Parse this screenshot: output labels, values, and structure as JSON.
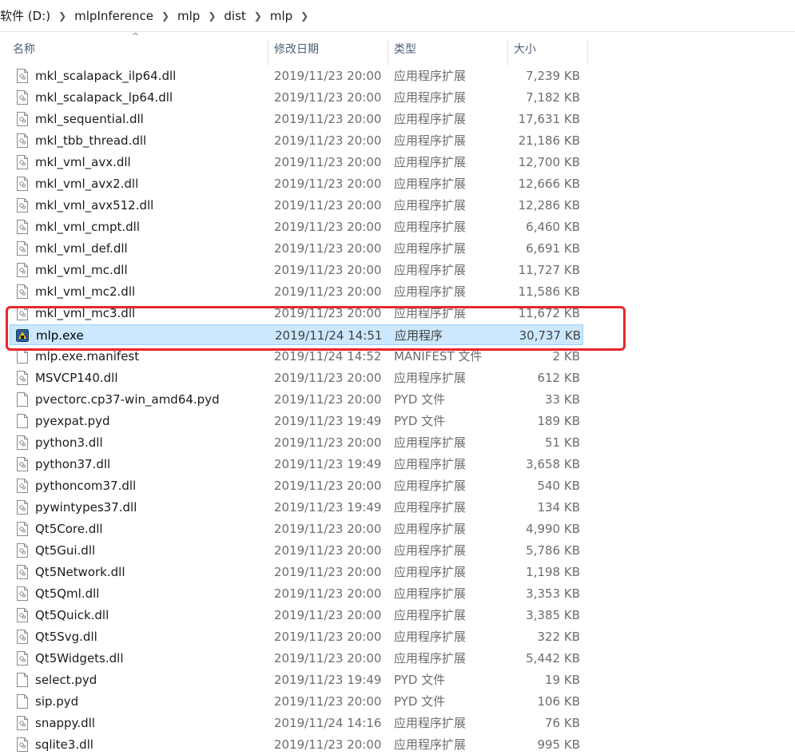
{
  "breadcrumb": [
    "软件 (D:)",
    "mlpInference",
    "mlp",
    "dist",
    "mlp"
  ],
  "columns": {
    "name": "名称",
    "date": "修改日期",
    "type": "类型",
    "size": "大小"
  },
  "colors": {
    "selected_bg": "#cce8ff",
    "selected_border": "#99d1ff",
    "highlight": "#e8262a"
  },
  "files": [
    {
      "name": "mkl_scalapack_ilp64.dll",
      "date": "2019/11/23 20:00",
      "type": "应用程序扩展",
      "size": "7,239 KB",
      "icon": "dll-file-icon"
    },
    {
      "name": "mkl_scalapack_lp64.dll",
      "date": "2019/11/23 20:00",
      "type": "应用程序扩展",
      "size": "7,182 KB",
      "icon": "dll-file-icon"
    },
    {
      "name": "mkl_sequential.dll",
      "date": "2019/11/23 20:00",
      "type": "应用程序扩展",
      "size": "17,631 KB",
      "icon": "dll-file-icon"
    },
    {
      "name": "mkl_tbb_thread.dll",
      "date": "2019/11/23 20:00",
      "type": "应用程序扩展",
      "size": "21,186 KB",
      "icon": "dll-file-icon"
    },
    {
      "name": "mkl_vml_avx.dll",
      "date": "2019/11/23 20:00",
      "type": "应用程序扩展",
      "size": "12,700 KB",
      "icon": "dll-file-icon"
    },
    {
      "name": "mkl_vml_avx2.dll",
      "date": "2019/11/23 20:00",
      "type": "应用程序扩展",
      "size": "12,666 KB",
      "icon": "dll-file-icon"
    },
    {
      "name": "mkl_vml_avx512.dll",
      "date": "2019/11/23 20:00",
      "type": "应用程序扩展",
      "size": "12,286 KB",
      "icon": "dll-file-icon"
    },
    {
      "name": "mkl_vml_cmpt.dll",
      "date": "2019/11/23 20:00",
      "type": "应用程序扩展",
      "size": "6,460 KB",
      "icon": "dll-file-icon"
    },
    {
      "name": "mkl_vml_def.dll",
      "date": "2019/11/23 20:00",
      "type": "应用程序扩展",
      "size": "6,691 KB",
      "icon": "dll-file-icon"
    },
    {
      "name": "mkl_vml_mc.dll",
      "date": "2019/11/23 20:00",
      "type": "应用程序扩展",
      "size": "11,727 KB",
      "icon": "dll-file-icon"
    },
    {
      "name": "mkl_vml_mc2.dll",
      "date": "2019/11/23 20:00",
      "type": "应用程序扩展",
      "size": "11,586 KB",
      "icon": "dll-file-icon"
    },
    {
      "name": "mkl_vml_mc3.dll",
      "date": "2019/11/23 20:00",
      "type": "应用程序扩展",
      "size": "11,672 KB",
      "icon": "dll-file-icon"
    },
    {
      "name": "mlp.exe",
      "date": "2019/11/24 14:51",
      "type": "应用程序",
      "size": "30,737 KB",
      "icon": "exe-app-icon",
      "selected": true
    },
    {
      "name": "mlp.exe.manifest",
      "date": "2019/11/24 14:52",
      "type": "MANIFEST 文件",
      "size": "2 KB",
      "icon": "blank-file-icon"
    },
    {
      "name": "MSVCP140.dll",
      "date": "2019/11/23 20:00",
      "type": "应用程序扩展",
      "size": "612 KB",
      "icon": "dll-file-icon"
    },
    {
      "name": "pvectorc.cp37-win_amd64.pyd",
      "date": "2019/11/23 20:00",
      "type": "PYD 文件",
      "size": "33 KB",
      "icon": "blank-file-icon"
    },
    {
      "name": "pyexpat.pyd",
      "date": "2019/11/23 19:49",
      "type": "PYD 文件",
      "size": "189 KB",
      "icon": "blank-file-icon"
    },
    {
      "name": "python3.dll",
      "date": "2019/11/23 20:00",
      "type": "应用程序扩展",
      "size": "51 KB",
      "icon": "dll-file-icon"
    },
    {
      "name": "python37.dll",
      "date": "2019/11/23 19:49",
      "type": "应用程序扩展",
      "size": "3,658 KB",
      "icon": "dll-file-icon"
    },
    {
      "name": "pythoncom37.dll",
      "date": "2019/11/23 20:00",
      "type": "应用程序扩展",
      "size": "540 KB",
      "icon": "dll-file-icon"
    },
    {
      "name": "pywintypes37.dll",
      "date": "2019/11/23 19:49",
      "type": "应用程序扩展",
      "size": "134 KB",
      "icon": "dll-file-icon"
    },
    {
      "name": "Qt5Core.dll",
      "date": "2019/11/23 20:00",
      "type": "应用程序扩展",
      "size": "4,990 KB",
      "icon": "dll-file-icon"
    },
    {
      "name": "Qt5Gui.dll",
      "date": "2019/11/23 20:00",
      "type": "应用程序扩展",
      "size": "5,786 KB",
      "icon": "dll-file-icon"
    },
    {
      "name": "Qt5Network.dll",
      "date": "2019/11/23 20:00",
      "type": "应用程序扩展",
      "size": "1,198 KB",
      "icon": "dll-file-icon"
    },
    {
      "name": "Qt5Qml.dll",
      "date": "2019/11/23 20:00",
      "type": "应用程序扩展",
      "size": "3,353 KB",
      "icon": "dll-file-icon"
    },
    {
      "name": "Qt5Quick.dll",
      "date": "2019/11/23 20:00",
      "type": "应用程序扩展",
      "size": "3,385 KB",
      "icon": "dll-file-icon"
    },
    {
      "name": "Qt5Svg.dll",
      "date": "2019/11/23 20:00",
      "type": "应用程序扩展",
      "size": "322 KB",
      "icon": "dll-file-icon"
    },
    {
      "name": "Qt5Widgets.dll",
      "date": "2019/11/23 20:00",
      "type": "应用程序扩展",
      "size": "5,442 KB",
      "icon": "dll-file-icon"
    },
    {
      "name": "select.pyd",
      "date": "2019/11/23 19:49",
      "type": "PYD 文件",
      "size": "19 KB",
      "icon": "blank-file-icon"
    },
    {
      "name": "sip.pyd",
      "date": "2019/11/23 20:00",
      "type": "PYD 文件",
      "size": "106 KB",
      "icon": "blank-file-icon"
    },
    {
      "name": "snappy.dll",
      "date": "2019/11/24 14:16",
      "type": "应用程序扩展",
      "size": "76 KB",
      "icon": "dll-file-icon"
    },
    {
      "name": "sqlite3.dll",
      "date": "2019/11/23 20:00",
      "type": "应用程序扩展",
      "size": "995 KB",
      "icon": "dll-file-icon"
    }
  ]
}
